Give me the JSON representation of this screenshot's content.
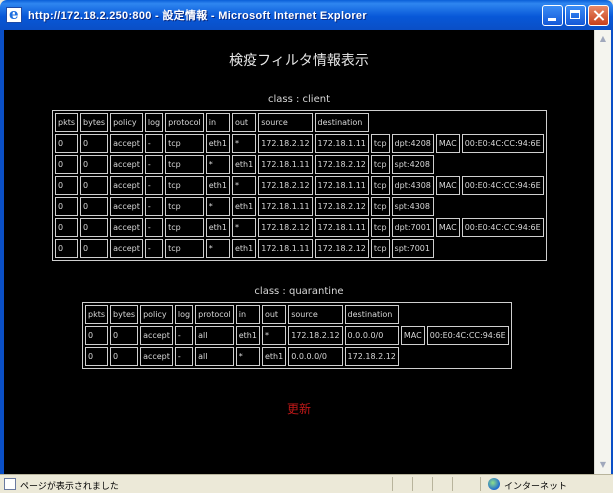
{
  "window": {
    "title": "http://172.18.2.250:800 - 設定情報 - Microsoft Internet Explorer"
  },
  "page": {
    "title": "検疫フィルタ情報表示",
    "update_link": "更新"
  },
  "client": {
    "title": "class : client",
    "headers": [
      "pkts",
      "bytes",
      "policy",
      "log",
      "protocol",
      "in",
      "out",
      "source",
      "destination"
    ],
    "rows": [
      [
        "0",
        "0",
        "accept",
        "-",
        "tcp",
        "eth1",
        "*",
        "172.18.2.12",
        "172.18.1.11",
        "tcp",
        "dpt:4208",
        "MAC",
        "00:E0:4C:CC:94:6E"
      ],
      [
        "0",
        "0",
        "accept",
        "-",
        "tcp",
        "*",
        "eth1",
        "172.18.1.11",
        "172.18.2.12",
        "tcp",
        "spt:4208"
      ],
      [
        "0",
        "0",
        "accept",
        "-",
        "tcp",
        "eth1",
        "*",
        "172.18.2.12",
        "172.18.1.11",
        "tcp",
        "dpt:4308",
        "MAC",
        "00:E0:4C:CC:94:6E"
      ],
      [
        "0",
        "0",
        "accept",
        "-",
        "tcp",
        "*",
        "eth1",
        "172.18.1.11",
        "172.18.2.12",
        "tcp",
        "spt:4308"
      ],
      [
        "0",
        "0",
        "accept",
        "-",
        "tcp",
        "eth1",
        "*",
        "172.18.2.12",
        "172.18.1.11",
        "tcp",
        "dpt:7001",
        "MAC",
        "00:E0:4C:CC:94:6E"
      ],
      [
        "0",
        "0",
        "accept",
        "-",
        "tcp",
        "*",
        "eth1",
        "172.18.1.11",
        "172.18.2.12",
        "tcp",
        "spt:7001"
      ]
    ]
  },
  "quarantine": {
    "title": "class : quarantine",
    "headers": [
      "pkts",
      "bytes",
      "policy",
      "log",
      "protocol",
      "in",
      "out",
      "source",
      "destination"
    ],
    "rows": [
      [
        "0",
        "0",
        "accept",
        "-",
        "all",
        "eth1",
        "*",
        "172.18.2.12",
        "0.0.0.0/0",
        "MAC",
        "00:E0:4C:CC:94:6E"
      ],
      [
        "0",
        "0",
        "accept",
        "-",
        "all",
        "*",
        "eth1",
        "0.0.0.0/0",
        "172.18.2.12"
      ]
    ]
  },
  "status": {
    "text": "ページが表示されました",
    "zone": "インターネット"
  },
  "colors": {
    "titlebar": "#0a58d8",
    "page_bg": "#000000",
    "update_link": "#c01818"
  }
}
